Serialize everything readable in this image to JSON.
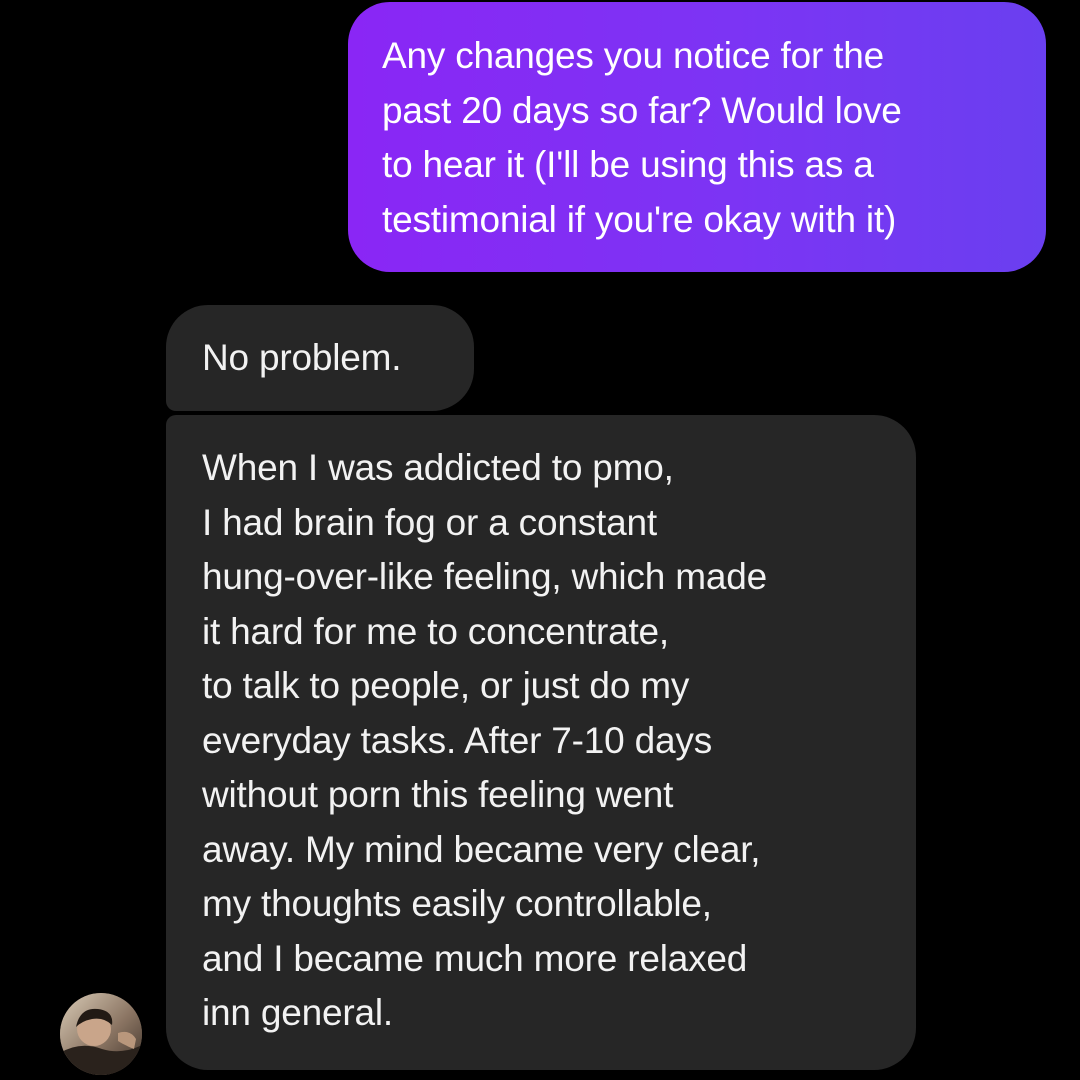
{
  "conversation": {
    "sent_messages": [
      {
        "text": "Any changes you notice for the\npast 20 days so far? Would love\nto hear it (I'll be using this as a\ntestimonial if you're okay with it)"
      }
    ],
    "received_messages": [
      {
        "text": "No problem."
      },
      {
        "text": "When I was addicted to pmo,\nI had brain fog or a constant\nhung-over-like feeling, which made\nit hard for me to concentrate,\nto talk to people, or just do my\neveryday tasks. After 7-10 days\nwithout porn this feeling went\naway. My mind became very clear,\nmy thoughts easily controllable,\nand I became much more relaxed\ninn general."
      }
    ]
  },
  "colors": {
    "background": "#000000",
    "sent_bubble_start": "#8a26f5",
    "sent_bubble_end": "#6a3ff0",
    "received_bubble": "#262626",
    "text": "#f2f2f2"
  },
  "avatar": {
    "icon": "user-avatar-photo"
  }
}
